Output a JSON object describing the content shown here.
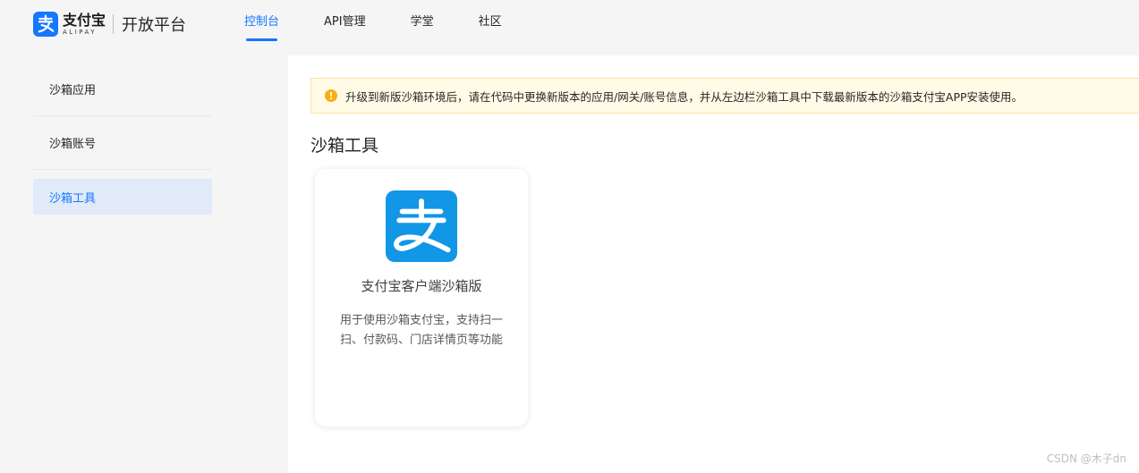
{
  "header": {
    "brand": "支付宝",
    "brand_sub": "ALIPAY",
    "platform": "开放平台",
    "brand_color": "#1677ff",
    "nav": [
      {
        "label": "控制台",
        "active": true
      },
      {
        "label": "API管理",
        "active": false
      },
      {
        "label": "学堂",
        "active": false
      },
      {
        "label": "社区",
        "active": false
      }
    ]
  },
  "sidebar": {
    "items": [
      {
        "label": "沙箱应用",
        "active": false
      },
      {
        "label": "沙箱账号",
        "active": false
      },
      {
        "label": "沙箱工具",
        "active": true
      }
    ]
  },
  "main": {
    "notice": {
      "icon": "warning-icon",
      "text": "升级到新版沙箱环境后，请在代码中更换新版本的应用/网关/账号信息，并从左边栏沙箱工具中下载最新版本的沙箱支付宝APP安装使用。"
    },
    "section_title": "沙箱工具",
    "card": {
      "icon": "alipay-logo-icon",
      "name": "支付宝客户端沙箱版",
      "description": "用于使用沙箱支付宝，支持扫一扫、付款码、门店详情页等功能"
    }
  },
  "watermark": "CSDN @木子dn"
}
